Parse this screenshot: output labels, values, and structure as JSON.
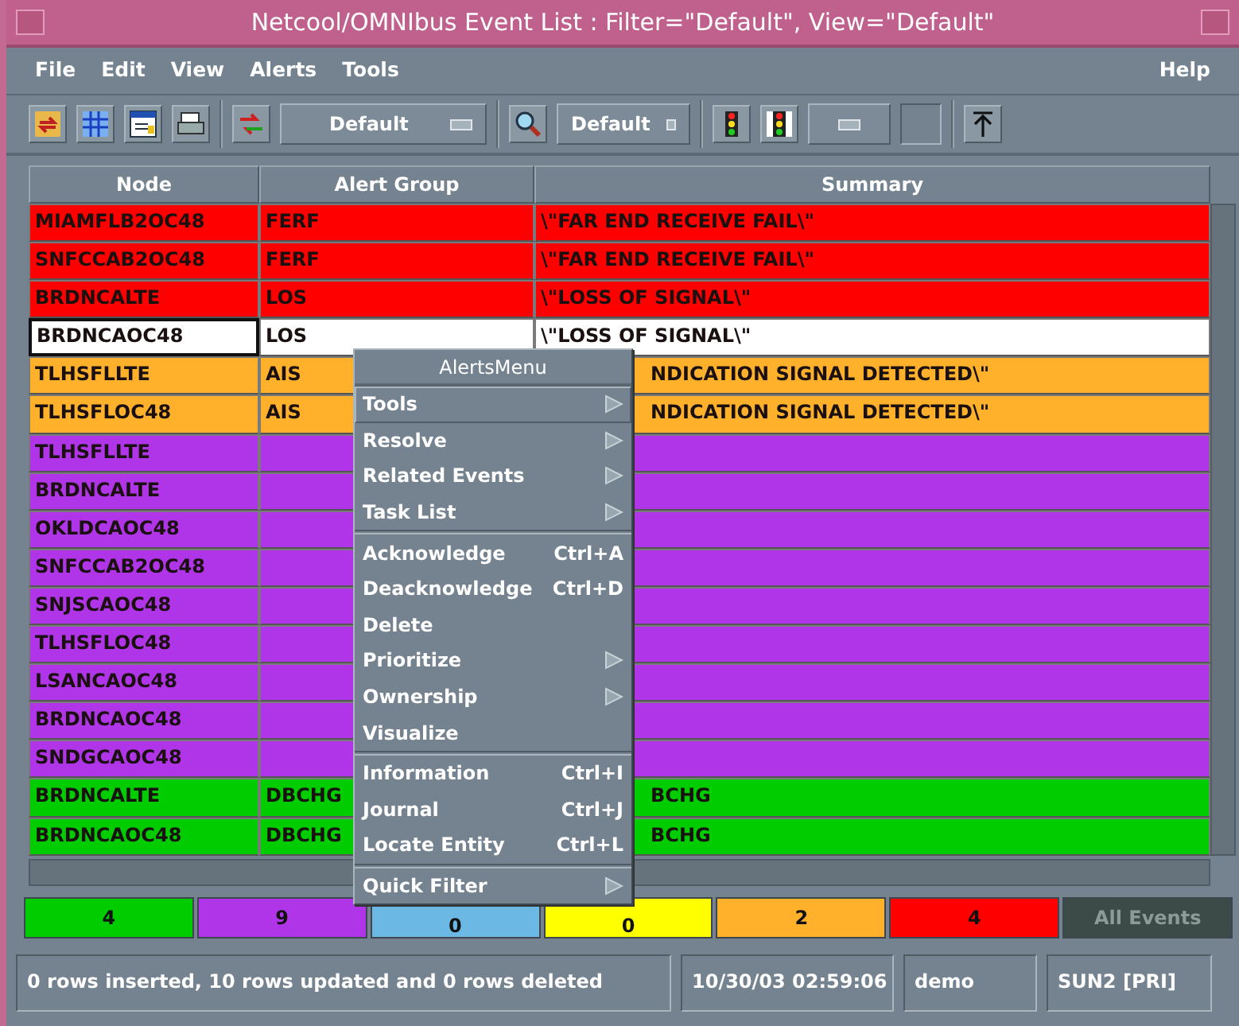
{
  "window": {
    "title": "Netcool/OMNIbus Event List : Filter=\"Default\", View=\"Default\""
  },
  "menubar": {
    "menus": [
      "File",
      "Edit",
      "View",
      "Alerts",
      "Tools"
    ],
    "help": "Help"
  },
  "toolbar": {
    "filter": "Default",
    "view": "Default"
  },
  "table": {
    "columns": [
      "Node",
      "Alert Group",
      "Summary"
    ],
    "rows": [
      {
        "node": "MIAMFLB2OC48",
        "alert_group": "FERF",
        "summary": "\\\"FAR END RECEIVE FAIL\\\"",
        "color": "#ff0000",
        "selected": false,
        "covered": false
      },
      {
        "node": "SNFCCAB2OC48",
        "alert_group": "FERF",
        "summary": "\\\"FAR END RECEIVE FAIL\\\"",
        "color": "#ff0000",
        "selected": false,
        "covered": false
      },
      {
        "node": "BRDNCALTE",
        "alert_group": "LOS",
        "summary": "\\\"LOSS OF SIGNAL\\\"",
        "color": "#ff0000",
        "selected": false,
        "covered": false
      },
      {
        "node": "BRDNCAOC48",
        "alert_group": "LOS",
        "summary": "\\\"LOSS OF SIGNAL\\\"",
        "color": "#ffffff",
        "selected": true,
        "covered": false
      },
      {
        "node": "TLHSFLLTE",
        "alert_group": "AIS",
        "summary": "NDICATION SIGNAL DETECTED\\\"",
        "color": "#ffb12c",
        "selected": false,
        "covered": true
      },
      {
        "node": "TLHSFLOC48",
        "alert_group": "AIS",
        "summary": "NDICATION SIGNAL DETECTED\\\"",
        "color": "#ffb12c",
        "selected": false,
        "covered": true
      },
      {
        "node": "TLHSFLLTE",
        "color": "#b035e8",
        "selected": false,
        "covered": false
      },
      {
        "node": "BRDNCALTE",
        "color": "#b035e8",
        "selected": false,
        "covered": false
      },
      {
        "node": "OKLDCAOC48",
        "color": "#b035e8",
        "selected": false,
        "covered": false
      },
      {
        "node": "SNFCCAB2OC48",
        "color": "#b035e8",
        "selected": false,
        "covered": false
      },
      {
        "node": "SNJSCAOC48",
        "color": "#b035e8",
        "selected": false,
        "covered": false
      },
      {
        "node": "TLHSFLOC48",
        "color": "#b035e8",
        "selected": false,
        "covered": false
      },
      {
        "node": "LSANCAOC48",
        "color": "#b035e8",
        "selected": false,
        "covered": false
      },
      {
        "node": "BRDNCAOC48",
        "color": "#b035e8",
        "selected": false,
        "covered": false
      },
      {
        "node": "SNDGCAOC48",
        "color": "#b035e8",
        "selected": false,
        "covered": false
      },
      {
        "node": "BRDNCALTE",
        "alert_group": "DBCHG",
        "summary": "BCHG",
        "color": "#00cc00",
        "selected": false,
        "covered": true
      },
      {
        "node": "BRDNCAOC48",
        "alert_group": "DBCHG",
        "summary": "BCHG",
        "color": "#00cc00",
        "selected": false,
        "covered": true
      }
    ]
  },
  "alerts_menu": {
    "title": "AlertsMenu",
    "groups": [
      [
        {
          "label": "Tools",
          "submenu": true,
          "selected": true
        },
        {
          "label": "Resolve",
          "submenu": true,
          "selected": false
        },
        {
          "label": "Related Events",
          "submenu": true,
          "selected": false
        },
        {
          "label": "Task List",
          "submenu": true,
          "selected": false
        }
      ],
      [
        {
          "label": "Acknowledge",
          "shortcut": "Ctrl+A",
          "submenu": false,
          "selected": false
        },
        {
          "label": "Deacknowledge",
          "shortcut": "Ctrl+D",
          "submenu": false,
          "selected": false
        },
        {
          "label": "Delete",
          "submenu": false,
          "selected": false
        },
        {
          "label": "Prioritize",
          "submenu": true,
          "selected": false
        },
        {
          "label": "Ownership",
          "submenu": true,
          "selected": false
        },
        {
          "label": "Visualize",
          "submenu": false,
          "selected": false
        }
      ],
      [
        {
          "label": "Information",
          "shortcut": "Ctrl+I",
          "submenu": false,
          "selected": false
        },
        {
          "label": "Journal",
          "shortcut": "Ctrl+J",
          "submenu": false,
          "selected": false
        },
        {
          "label": "Locate Entity",
          "shortcut": "Ctrl+L",
          "submenu": false,
          "selected": false
        }
      ],
      [
        {
          "label": "Quick Filter",
          "submenu": true,
          "selected": false
        }
      ]
    ]
  },
  "severity_counts": [
    {
      "count": "4",
      "color": "#00cc00"
    },
    {
      "count": "9",
      "color": "#b035e8"
    },
    {
      "count": "0",
      "color": "#6cb8e4"
    },
    {
      "count": "0",
      "color": "#ffff00"
    },
    {
      "count": "2",
      "color": "#ffb12c"
    },
    {
      "count": "4",
      "color": "#ff0000"
    }
  ],
  "all_events": "All Events",
  "status_bar": {
    "message": "0 rows inserted, 10 rows updated and 0 rows deleted",
    "time": "10/30/03 02:59:06",
    "user": "demo",
    "server": "SUN2 [PRI]"
  }
}
